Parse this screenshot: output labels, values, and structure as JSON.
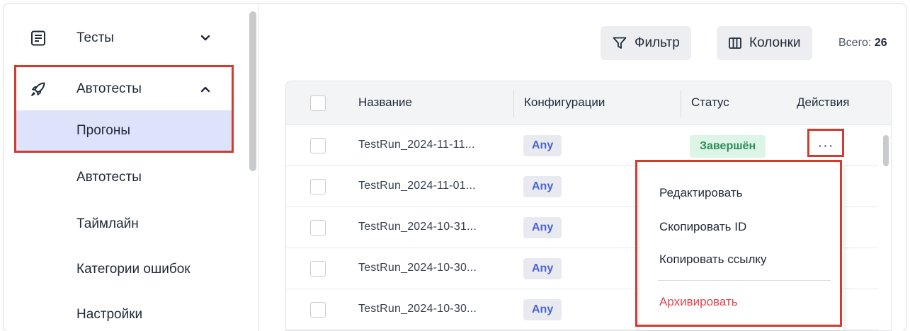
{
  "sidebar": {
    "groups": [
      {
        "label": "Тесты",
        "icon": "document-list-icon",
        "expanded": false
      },
      {
        "label": "Автотесты",
        "icon": "rocket-icon",
        "expanded": true
      }
    ],
    "sub_items": [
      {
        "label": "Прогоны",
        "active": true
      },
      {
        "label": "Автотесты",
        "active": false
      },
      {
        "label": "Таймлайн",
        "active": false
      },
      {
        "label": "Категории ошибок",
        "active": false
      },
      {
        "label": "Настройки",
        "active": false
      }
    ]
  },
  "toolbar": {
    "filter_label": "Фильтр",
    "columns_label": "Колонки",
    "total_label": "Всего:",
    "total_value": "26"
  },
  "table": {
    "columns": [
      "Название",
      "Конфигурации",
      "Статус",
      "Действия"
    ],
    "rows": [
      {
        "name": "TestRun_2024-11-11...",
        "config": "Any",
        "status": "Завершён"
      },
      {
        "name": "TestRun_2024-11-01...",
        "config": "Any",
        "status": ""
      },
      {
        "name": "TestRun_2024-10-31...",
        "config": "Any",
        "status": ""
      },
      {
        "name": "TestRun_2024-10-30...",
        "config": "Any",
        "status": ""
      },
      {
        "name": "TestRun_2024-10-30...",
        "config": "Any",
        "status": ""
      }
    ],
    "actions_glyph": "···"
  },
  "context_menu": {
    "items": [
      "Редактировать",
      "Скопировать ID",
      "Копировать ссылку"
    ],
    "danger_item": "Архивировать"
  },
  "colors": {
    "accent": "#4a63d6",
    "active_bg": "#dde3fb",
    "highlight": "#d13b30",
    "success_text": "#2e8b57",
    "success_bg": "#dcf5e6",
    "danger": "#e0454f"
  }
}
